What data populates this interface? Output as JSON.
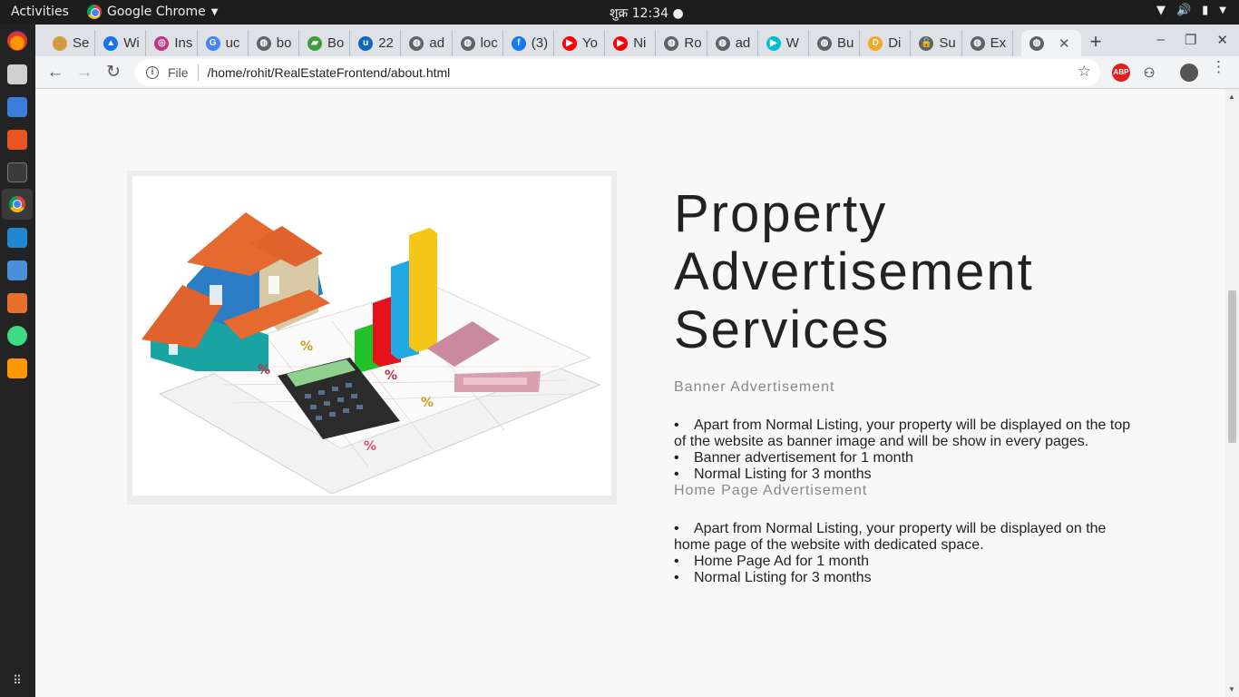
{
  "system": {
    "activities": "Activities",
    "app_name": "Google Chrome",
    "clock": "शुक्र 12:34 ●"
  },
  "tabs": [
    {
      "label": "Se",
      "fav_color": "#d39b43",
      "fav_text": ""
    },
    {
      "label": "Wi",
      "fav_color": "#1a73e8",
      "fav_text": "▲"
    },
    {
      "label": "Ins",
      "fav_color": "#c13584",
      "fav_text": "◎"
    },
    {
      "label": "uc",
      "fav_color": "#4285f4",
      "fav_text": "G"
    },
    {
      "label": "bo",
      "fav_color": "#5f6368",
      "fav_text": "◍"
    },
    {
      "label": "Bo",
      "fav_color": "#3c9d3c",
      "fav_text": "▰"
    },
    {
      "label": "22",
      "fav_color": "#1566b9",
      "fav_text": "u"
    },
    {
      "label": "ad",
      "fav_color": "#5f6368",
      "fav_text": "◍"
    },
    {
      "label": "loc",
      "fav_color": "#5f6368",
      "fav_text": "◍"
    },
    {
      "label": "(3)",
      "fav_color": "#1877f2",
      "fav_text": "f"
    },
    {
      "label": "Yo",
      "fav_color": "#ff0000",
      "fav_text": "▶"
    },
    {
      "label": "Ni",
      "fav_color": "#ff0000",
      "fav_text": "▶"
    },
    {
      "label": "Ro",
      "fav_color": "#5f6368",
      "fav_text": "◍"
    },
    {
      "label": "ad",
      "fav_color": "#5f6368",
      "fav_text": "◍"
    },
    {
      "label": "W",
      "fav_color": "#00bcd4",
      "fav_text": "▶"
    },
    {
      "label": "Bu",
      "fav_color": "#5f6368",
      "fav_text": "◍"
    },
    {
      "label": "Di",
      "fav_color": "#f5a623",
      "fav_text": "D"
    },
    {
      "label": "Su",
      "fav_color": "#5f6368",
      "fav_text": "🔓"
    },
    {
      "label": "Ex",
      "fav_color": "#5f6368",
      "fav_text": "◍"
    }
  ],
  "active_tab": {
    "label": "",
    "fav_color": "#5f6368"
  },
  "omnibox": {
    "scheme_label": "File",
    "url": "/home/rohit/RealEstateFrontend/about.html"
  },
  "extensions": {
    "abp": "ABP"
  },
  "page": {
    "title_lines": [
      "Property",
      "Advertisement",
      "Services"
    ],
    "banner": {
      "heading": "Banner Advertisement",
      "items": [
        "Apart from Normal Listing, your property will be displayed on the top of the website as banner image and will be show in every pages.",
        "Banner advertisement for 1 month",
        "Normal Listing for 3 months"
      ]
    },
    "homepage": {
      "heading": "Home Page Advertisement",
      "items": [
        "Apart from Normal Listing, your property will be displayed on the home page of the website with dedicated space.",
        "Home Page Ad for 1 month",
        "Normal Listing for 3 months"
      ]
    }
  }
}
